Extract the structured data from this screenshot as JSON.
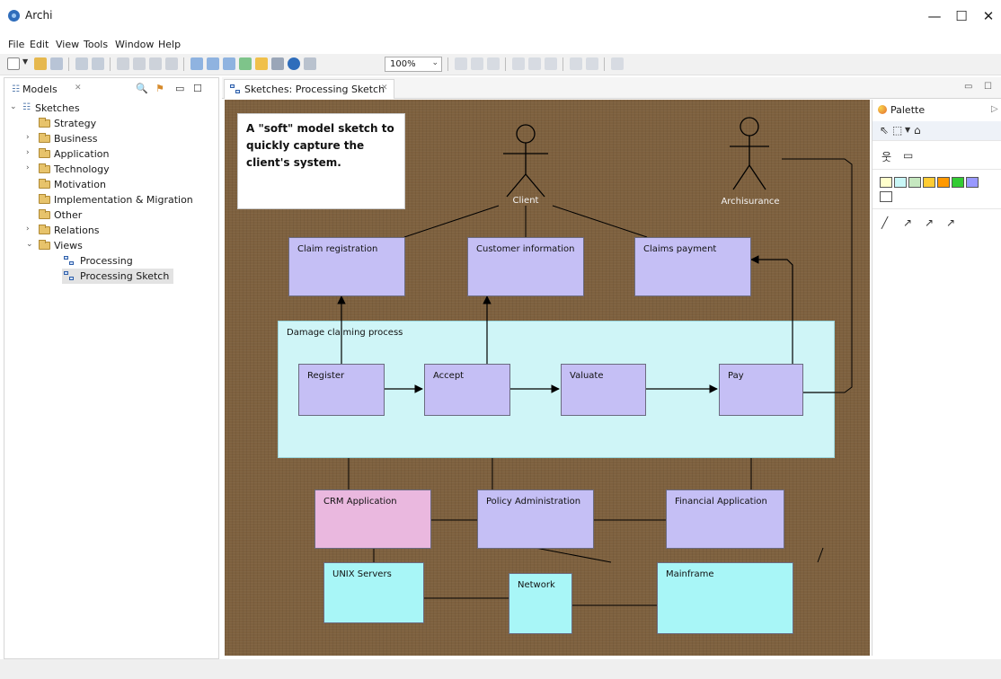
{
  "window": {
    "title": "Archi",
    "minimize": "—",
    "maximize": "☐",
    "close": "✕"
  },
  "menu": [
    "File",
    "Edit",
    "View",
    "Tools",
    "Window",
    "Help"
  ],
  "toolbar": {
    "zoom": "100%"
  },
  "models_panel": {
    "tab_label": "Models",
    "tree": {
      "root": "Sketches",
      "folders": [
        {
          "label": "Strategy",
          "expandable": false
        },
        {
          "label": "Business",
          "expandable": true
        },
        {
          "label": "Application",
          "expandable": true
        },
        {
          "label": "Technology",
          "expandable": true
        },
        {
          "label": "Motivation",
          "expandable": false
        },
        {
          "label": "Implementation & Migration",
          "expandable": false
        },
        {
          "label": "Other",
          "expandable": false
        },
        {
          "label": "Relations",
          "expandable": true
        },
        {
          "label": "Views",
          "expandable": true
        }
      ],
      "views": [
        {
          "label": "Processing",
          "selected": false
        },
        {
          "label": "Processing Sketch",
          "selected": true
        }
      ]
    }
  },
  "editor": {
    "tab_label": "Sketches: Processing Sketch",
    "note": "A \"soft\" model sketch to quickly capture the client's system.",
    "actors": {
      "client": "Client",
      "archisurance": "Archisurance"
    },
    "services": {
      "claim_registration": "Claim registration",
      "customer_information": "Customer information",
      "claims_payment": "Claims payment"
    },
    "process_group": "Damage claiming process",
    "steps": {
      "register": "Register",
      "accept": "Accept",
      "valuate": "Valuate",
      "pay": "Pay"
    },
    "applications": {
      "crm": "CRM Application",
      "policy": "Policy Administration",
      "financial": "Financial Application"
    },
    "infrastructure": {
      "unix": "UNIX Servers",
      "network": "Network",
      "mainframe": "Mainframe"
    }
  },
  "palette": {
    "title": "Palette",
    "colors": [
      "#ffffcc",
      "#c9f7f7",
      "#c6e8c0",
      "#ffcc33",
      "#ff9900",
      "#33cc33",
      "#9999ff",
      "#ffffff"
    ]
  }
}
